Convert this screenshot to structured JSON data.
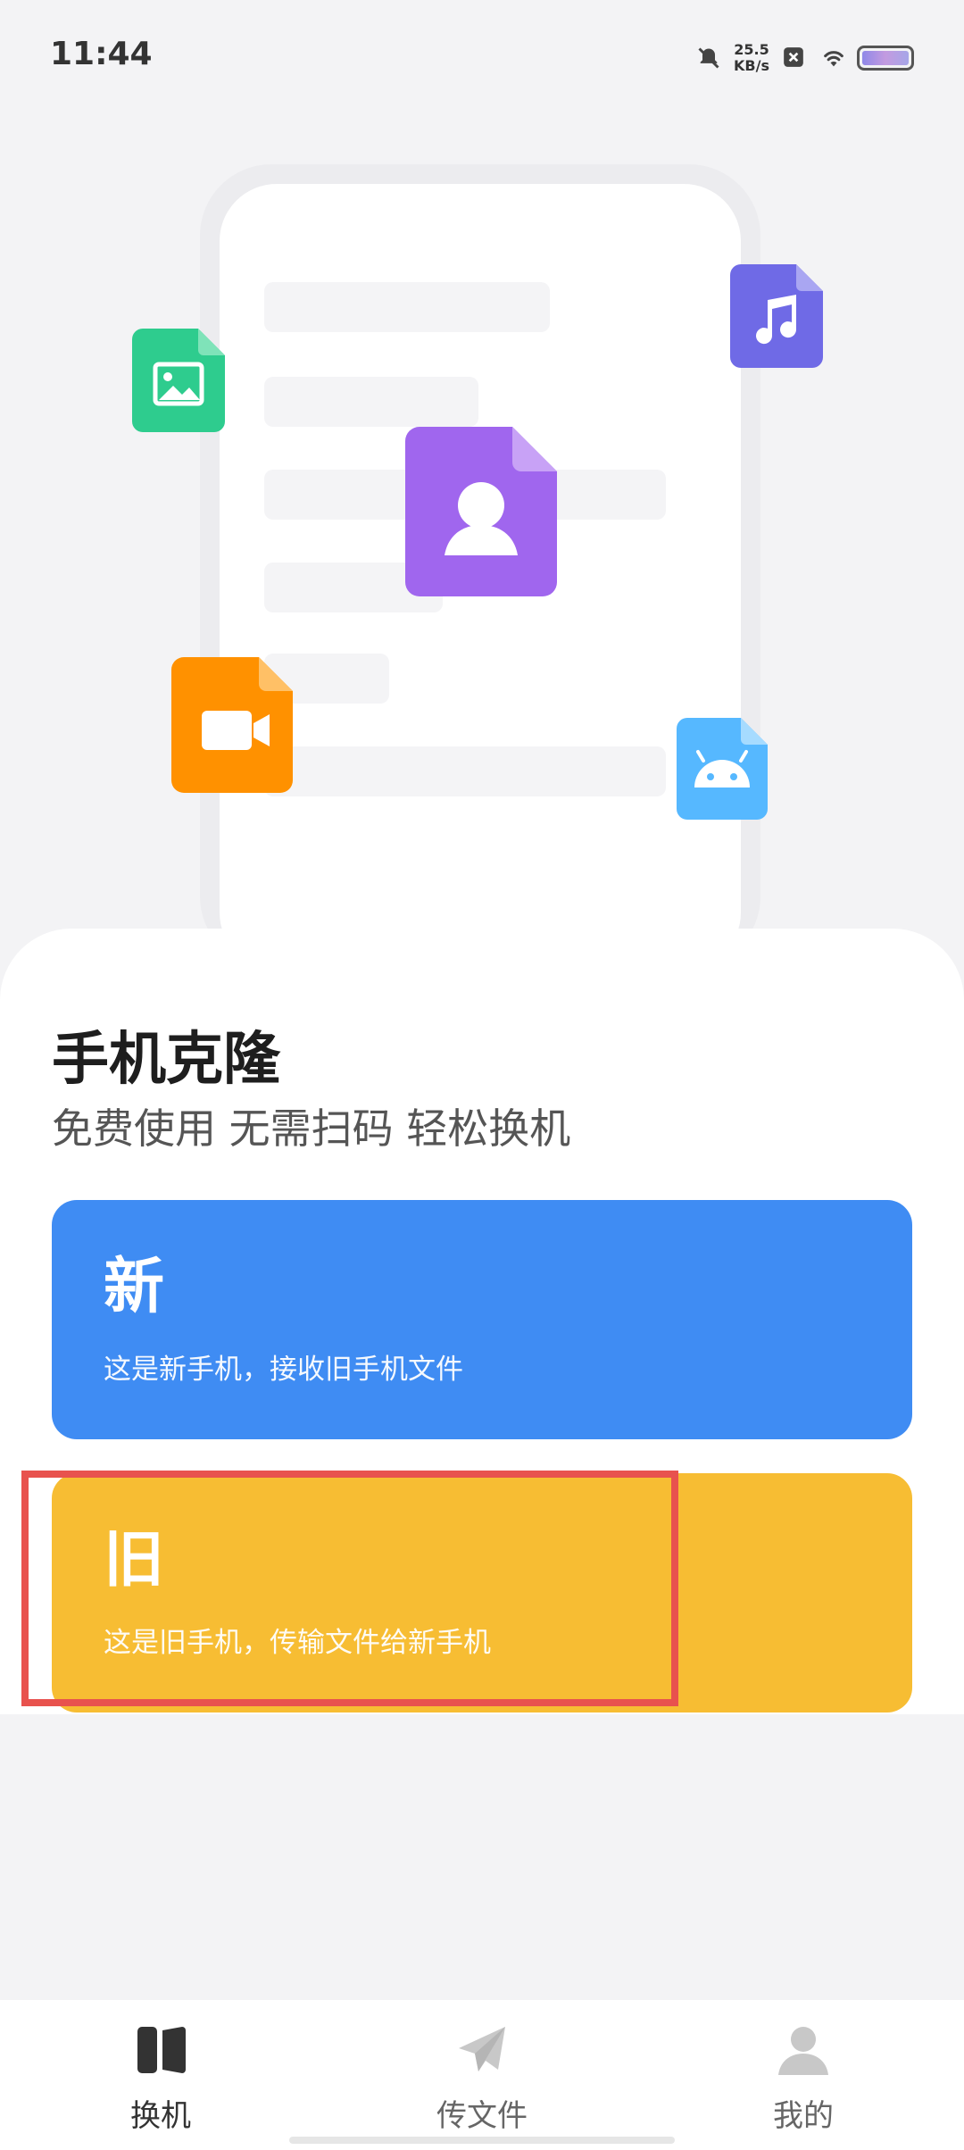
{
  "status_bar": {
    "time": "11:44",
    "net_speed_value": "25.5",
    "net_speed_unit": "KB/s",
    "icons": [
      "mute-bell-icon",
      "close-box-icon",
      "wifi-icon",
      "battery-icon"
    ]
  },
  "hero": {
    "file_icons": [
      "image-file-icon",
      "music-file-icon",
      "contact-file-icon",
      "video-file-icon",
      "android-file-icon"
    ],
    "colors": {
      "image": "#2ecc8e",
      "music": "#6f6ae6",
      "contact": "#a066ee",
      "video": "#ff9100",
      "android": "#56b8ff"
    }
  },
  "main": {
    "title": "手机克隆",
    "subtitle": "免费使用 无需扫码 轻松换机"
  },
  "cards": {
    "new": {
      "label": "新",
      "desc": "这是新手机，接收旧手机文件",
      "color": "#3f8cf3"
    },
    "old": {
      "label": "旧",
      "desc": "这是旧手机，传输文件给新手机",
      "color": "#f7bd33"
    }
  },
  "bottom_nav": {
    "items": [
      {
        "label": "换机",
        "icon": "phone-switch-icon",
        "active": true
      },
      {
        "label": "传文件",
        "icon": "paper-plane-icon",
        "active": false
      },
      {
        "label": "我的",
        "icon": "user-icon",
        "active": false
      }
    ]
  },
  "highlight_color": "#e8524e"
}
